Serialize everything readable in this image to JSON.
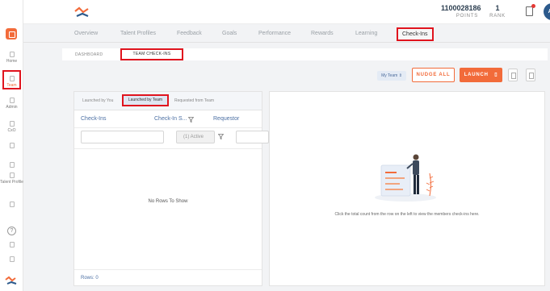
{
  "header": {
    "points_value": "1100028186",
    "points_label": "POINTS",
    "rank_value": "1",
    "rank_label": "RANK",
    "avatar_initials": "AS"
  },
  "sidebar": {
    "items": [
      {
        "label": "Home"
      },
      {
        "label": "Team"
      },
      {
        "label": "Admin"
      },
      {
        "label": "CxO"
      },
      {
        "label": "Talent Profile"
      }
    ],
    "help_symbol": "?"
  },
  "nav": {
    "tabs": [
      "Overview",
      "Talent Profiles",
      "Feedback",
      "Goals",
      "Performance",
      "Rewards",
      "Learning",
      "Check-Ins"
    ],
    "active": "Check-Ins"
  },
  "subnav": {
    "tabs": [
      "DASHBOARD",
      "TEAM CHECK-INS"
    ]
  },
  "actions": {
    "scope_select": "My Team",
    "nudge_label": "NUDGE ALL",
    "launch_label": "LAUNCH"
  },
  "checkins_table": {
    "tabs": [
      "Launched by You",
      "Launched by Team",
      "Requested from Team"
    ],
    "columns": [
      "Check-Ins",
      "Check-In S...",
      "Requestor"
    ],
    "status_filter_value": "(1) Active",
    "empty_message": "No Rows To Show",
    "rows_label": "Rows: 0"
  },
  "detail_panel": {
    "message": "Click the total count from the row on the left to view the members check-ins here."
  },
  "colors": {
    "accent": "#f26b3a",
    "highlight_border": "#e0141e",
    "link_blue": "#4b6fa3",
    "avatar_bg": "#2c5a8c"
  },
  "icons": [
    "logo-icon",
    "home-icon",
    "team-icon",
    "admin-icon",
    "cxo-icon",
    "talent-profile-icon",
    "help-icon",
    "document-icon",
    "filter-icon",
    "grid-icon",
    "export-icon"
  ]
}
